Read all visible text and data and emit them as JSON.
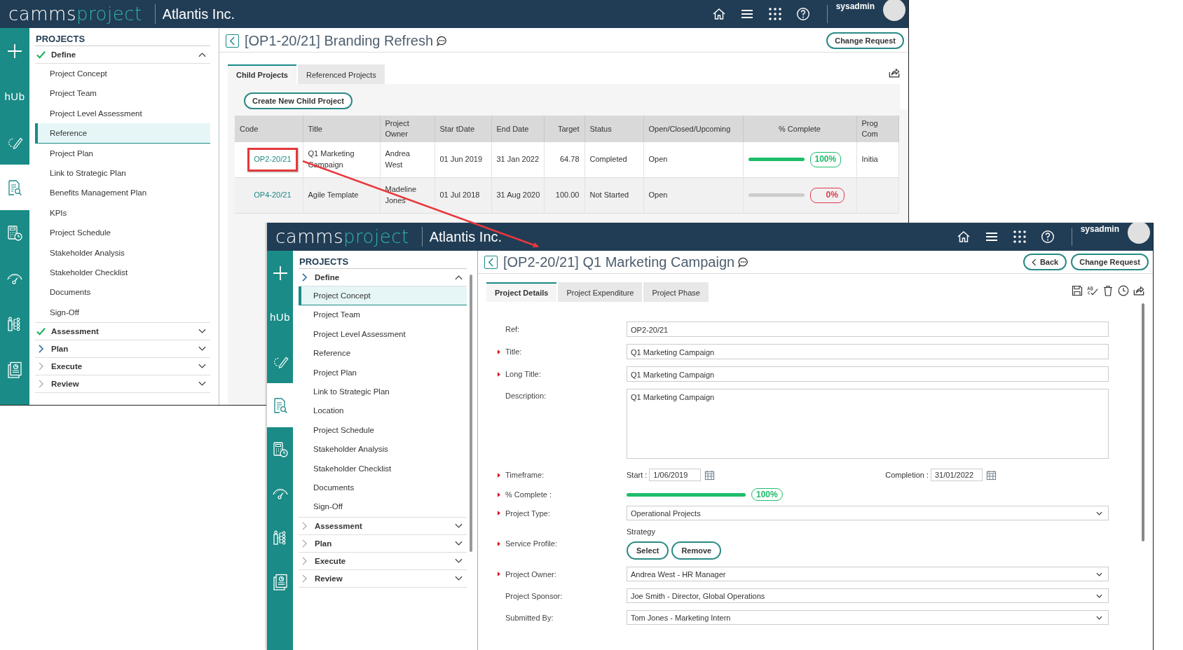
{
  "back_window": {
    "header": {
      "logo_a": "camms",
      "logo_b": "project",
      "company": "Atlantis Inc.",
      "user": "sysadmin"
    },
    "rail": [
      {
        "kind": "plus",
        "selected": false
      },
      {
        "kind": "hub",
        "label": "hUb",
        "selected": false
      },
      {
        "kind": "edit",
        "selected": false
      },
      {
        "kind": "document",
        "selected": true
      },
      {
        "kind": "calculator",
        "selected": false
      },
      {
        "kind": "gauge",
        "selected": false
      },
      {
        "kind": "hierarchy",
        "selected": false
      },
      {
        "kind": "report",
        "selected": false
      }
    ],
    "sidebar": {
      "title": "PROJECTS",
      "sections": [
        {
          "label": "Define",
          "kind": "done",
          "expanded": true,
          "items": [
            {
              "label": "Project Concept",
              "selected": false
            },
            {
              "label": "Project Team",
              "selected": false
            },
            {
              "label": "Project Level Assessment",
              "selected": false
            },
            {
              "label": "Reference",
              "selected": true
            },
            {
              "label": "Project Plan",
              "selected": false
            },
            {
              "label": "Link to Strategic Plan",
              "selected": false
            },
            {
              "label": "Benefits Management Plan",
              "selected": false
            },
            {
              "label": "KPIs",
              "selected": false
            },
            {
              "label": "Project Schedule",
              "selected": false
            },
            {
              "label": "Stakeholder Analysis",
              "selected": false
            },
            {
              "label": "Stakeholder Checklist",
              "selected": false
            },
            {
              "label": "Documents",
              "selected": false
            },
            {
              "label": "Sign-Off",
              "selected": false
            }
          ]
        },
        {
          "label": "Assessment",
          "kind": "done",
          "expanded": false
        },
        {
          "label": "Plan",
          "kind": "current",
          "expanded": false
        },
        {
          "label": "Execute",
          "kind": "pending",
          "expanded": false
        },
        {
          "label": "Review",
          "kind": "pending",
          "expanded": false
        }
      ]
    },
    "page": {
      "title": "[OP1-20/21] Branding Refresh",
      "buttons": [
        "Change Request"
      ],
      "tabs": [
        {
          "label": "Child Projects",
          "selected": true
        },
        {
          "label": "Referenced Projects",
          "selected": false
        }
      ],
      "create_button": "Create New Child Project",
      "table": {
        "columns": [
          "Code",
          "Title",
          "Project Owner",
          "Star tDate",
          "End Date",
          "Target",
          "Status",
          "Open/Closed/Upcoming",
          "% Complete",
          "Prog Com"
        ],
        "rows": [
          {
            "code": "OP2-20/21",
            "highlighted": true,
            "title": "Q1 Marketing Campaign",
            "owner": "Andrea West",
            "start": "01 Jun 2019",
            "end": "31 Jan 2022",
            "target": "64.78",
            "status": "Completed",
            "open": "Open",
            "level": 1,
            "percent": "100%",
            "prog": "Initia"
          },
          {
            "code": "OP4-20/21",
            "highlighted": false,
            "title": "Agile Template",
            "owner": "Madeline Jones",
            "start": "01 Jul 2018",
            "end": "31 Aug 2020",
            "target": "100.00",
            "status": "Not Started",
            "open": "Open",
            "level": 0,
            "percent": "0%"
          }
        ]
      }
    }
  },
  "front_window": {
    "header": {
      "logo_a": "camms",
      "logo_b": "project",
      "company": "Atlantis Inc.",
      "user": "sysadmin"
    },
    "rail": [
      {
        "kind": "plus",
        "selected": false
      },
      {
        "kind": "hub",
        "label": "hUb",
        "selected": false
      },
      {
        "kind": "edit",
        "selected": false
      },
      {
        "kind": "document",
        "selected": true
      },
      {
        "kind": "calculator",
        "selected": false
      },
      {
        "kind": "gauge",
        "selected": false
      },
      {
        "kind": "hierarchy",
        "selected": false
      },
      {
        "kind": "report",
        "selected": false
      }
    ],
    "sidebar": {
      "title": "PROJECTS",
      "sections": [
        {
          "label": "Define",
          "kind": "current",
          "expanded": true,
          "items": [
            {
              "label": "Project Concept",
              "selected": true
            },
            {
              "label": "Project Team",
              "selected": false
            },
            {
              "label": "Project Level Assessment",
              "selected": false
            },
            {
              "label": "Reference",
              "selected": false
            },
            {
              "label": "Project Plan",
              "selected": false
            },
            {
              "label": "Link to Strategic Plan",
              "selected": false
            },
            {
              "label": "Location",
              "selected": false
            },
            {
              "label": "Project Schedule",
              "selected": false
            },
            {
              "label": "Stakeholder Analysis",
              "selected": false
            },
            {
              "label": "Stakeholder Checklist",
              "selected": false
            },
            {
              "label": "Documents",
              "selected": false
            },
            {
              "label": "Sign-Off",
              "selected": false
            }
          ]
        },
        {
          "label": "Assessment",
          "kind": "pending",
          "expanded": false
        },
        {
          "label": "Plan",
          "kind": "pending",
          "expanded": false
        },
        {
          "label": "Execute",
          "kind": "pending",
          "expanded": false
        },
        {
          "label": "Review",
          "kind": "pending",
          "expanded": false
        }
      ]
    },
    "page": {
      "title": "[OP2-20/21] Q1 Marketing Campaign",
      "back_button": "Back",
      "buttons": [
        "Change Request"
      ],
      "tabs": [
        {
          "label": "Project Details",
          "selected": true
        },
        {
          "label": "Project Expenditure",
          "selected": false
        },
        {
          "label": "Project Phase",
          "selected": false
        }
      ],
      "fields": [
        {
          "kind": "text",
          "label": "Ref:",
          "required": false,
          "value": "OP2-20/21"
        },
        {
          "kind": "text",
          "label": "Title:",
          "required": true,
          "value": "Q1 Marketing Campaign"
        },
        {
          "kind": "text",
          "label": "Long Title:",
          "required": true,
          "value": "Q1 Marketing Campaign"
        },
        {
          "kind": "textarea",
          "label": "Description:",
          "required": false,
          "value": "Q1 Marketing Campaign"
        },
        {
          "kind": "dates",
          "label": "Timeframe:",
          "required": true,
          "start_label": "Start :",
          "start": "1/06/2019",
          "end_label": "Completion :",
          "end": "31/01/2022"
        },
        {
          "kind": "progress",
          "label": "% Complete :",
          "required": true,
          "level": 1,
          "percent": "100%"
        },
        {
          "kind": "select",
          "label": "Project Type:",
          "required": true,
          "value": "Operational Projects"
        },
        {
          "kind": "profile",
          "label": "Service Profile:",
          "required": true,
          "note": "Strategy",
          "buttons": [
            "Select",
            "Remove"
          ]
        },
        {
          "kind": "select",
          "label": "Project Owner:",
          "required": true,
          "value": "Andrea West - HR Manager"
        },
        {
          "kind": "select",
          "label": "Project Sponsor:",
          "required": false,
          "value": "Joe Smith - Director, Global Operations"
        },
        {
          "kind": "select",
          "label": "Submitted By:",
          "required": false,
          "value": "Tom Jones - Marketing Intern"
        }
      ]
    }
  }
}
